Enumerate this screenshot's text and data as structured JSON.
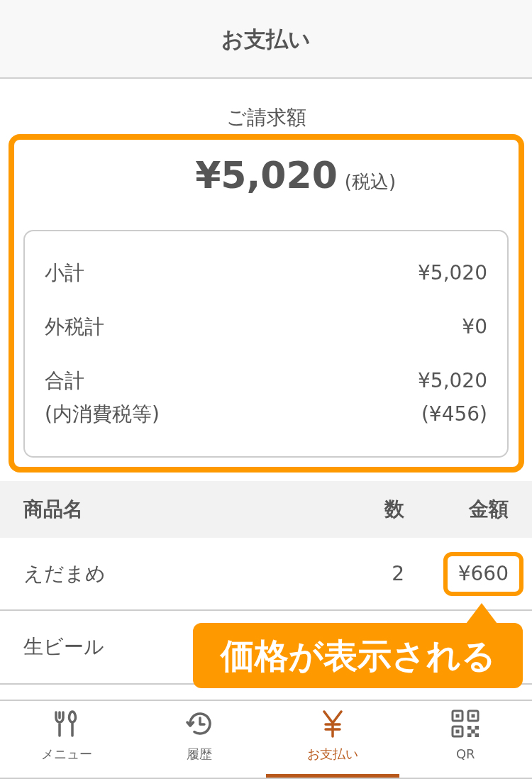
{
  "header": {
    "title": "お支払い"
  },
  "billing": {
    "label": "ご請求額",
    "total": "¥5,020",
    "tax_note": "(税込)",
    "highlighted": true,
    "breakdown": [
      {
        "label": "小計",
        "value": "¥5,020"
      },
      {
        "label": "外税計",
        "value": "¥0"
      },
      {
        "label": "合計",
        "value": "¥5,020",
        "sub_label": "(内消費税等)",
        "sub_value": "(¥456)"
      }
    ]
  },
  "table": {
    "columns": [
      "商品名",
      "数",
      "金額"
    ],
    "rows": [
      {
        "name": "えだまめ",
        "quantity": "2",
        "amount": "¥660",
        "highlighted": true
      },
      {
        "name": "生ビール"
      }
    ]
  },
  "annotation": {
    "text": "価格が表示される"
  },
  "tabs": [
    {
      "kind": "menu",
      "label": "メニュー",
      "selected": false
    },
    {
      "kind": "history",
      "label": "履歴",
      "selected": false
    },
    {
      "kind": "payment",
      "label": "お支払い",
      "selected": true
    },
    {
      "kind": "qr",
      "label": "QR",
      "selected": false
    }
  ]
}
